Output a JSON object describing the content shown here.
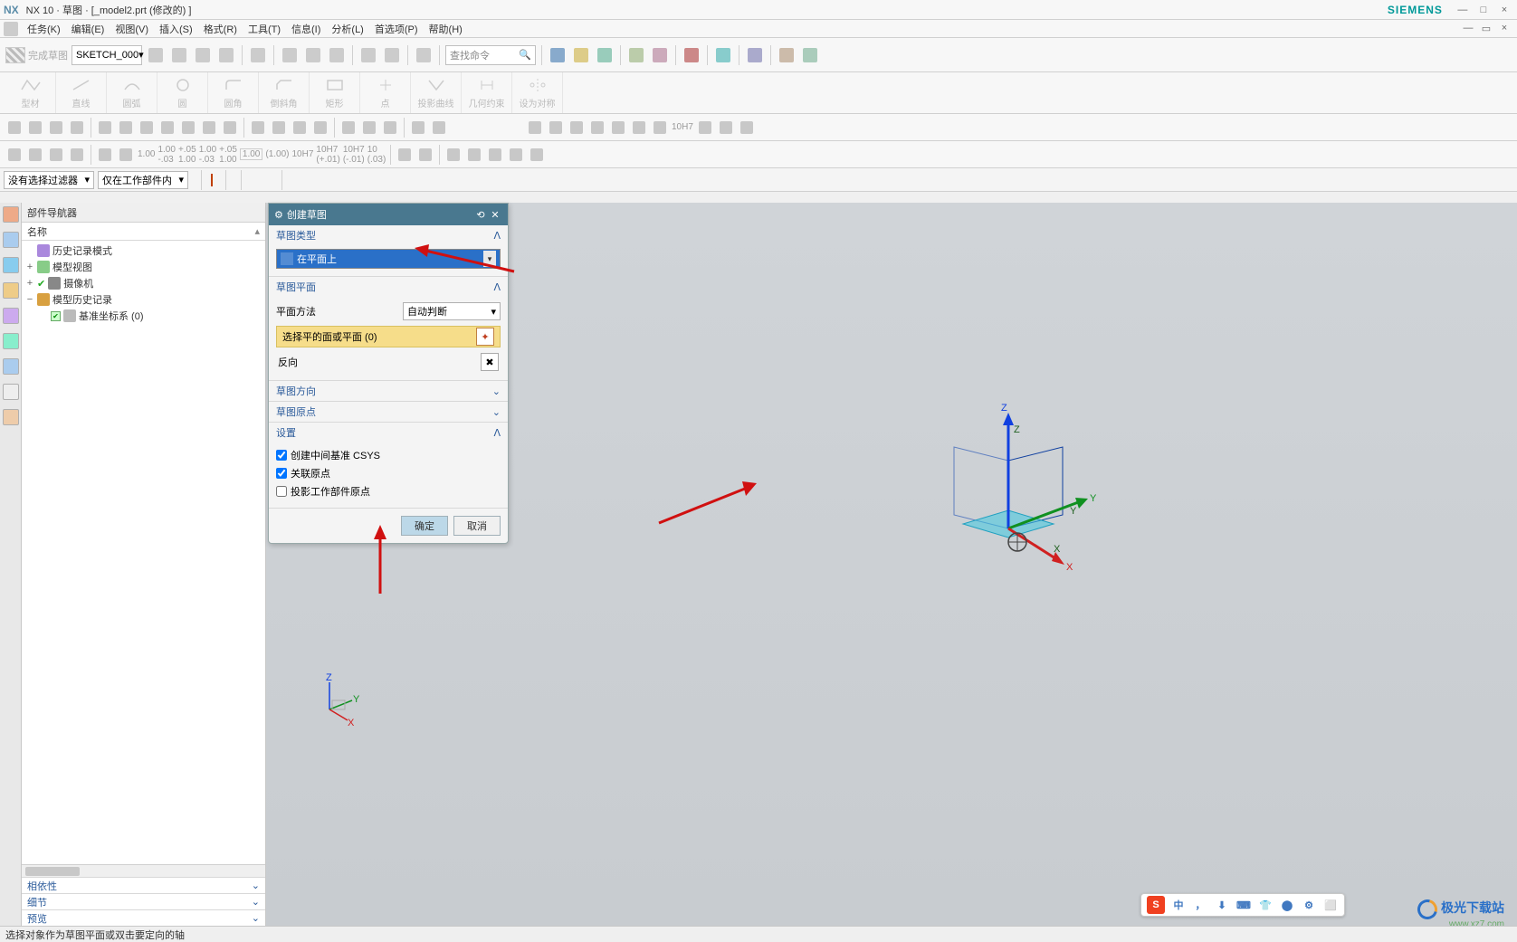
{
  "titlebar": {
    "logo": "NX",
    "title": "NX 10 · 草图 · [_model2.prt  (修改的)  ]",
    "brand": "SIEMENS",
    "min": "—",
    "max": "□",
    "close": "×"
  },
  "menu": {
    "items": [
      "任务(K)",
      "编辑(E)",
      "视图(V)",
      "插入(S)",
      "格式(R)",
      "工具(T)",
      "信息(I)",
      "分析(L)",
      "首选项(P)",
      "帮助(H)"
    ],
    "minbtn": "—",
    "maxbtn": "▭",
    "closebtn": "×"
  },
  "toolbar1": {
    "finish": "完成草图",
    "sketch_name": "SKETCH_000",
    "search_placeholder": "查找命令"
  },
  "ribbon": {
    "items": [
      "型材",
      "直线",
      "圆弧",
      "圆",
      "圆角",
      "倒斜角",
      "矩形",
      "点",
      "投影曲线",
      "几何约束",
      "设为对称"
    ]
  },
  "filters": {
    "filter_label": "没有选择过滤器",
    "scope_label": "仅在工作部件内"
  },
  "nav": {
    "title": "部件导航器",
    "col": "名称",
    "items": {
      "history_mode": "历史记录模式",
      "model_view": "模型视图",
      "camera": "摄像机",
      "model_history": "模型历史记录",
      "datum_csys": "基准坐标系 (0)"
    },
    "collapse": {
      "depend": "相依性",
      "detail": "细节",
      "preview": "预览"
    }
  },
  "dialog": {
    "title": "创建草图",
    "sections": {
      "type": "草图类型",
      "plane": "草图平面",
      "orient": "草图方向",
      "origin": "草图原点",
      "settings": "设置"
    },
    "type_value": "在平面上",
    "plane_method_label": "平面方法",
    "plane_method_value": "自动判断",
    "select_plane": "选择平的面或平面 (0)",
    "reverse": "反向",
    "cb_csys": "创建中间基准 CSYS",
    "cb_assoc_origin": "关联原点",
    "cb_project_origin": "投影工作部件原点",
    "ok": "确定",
    "cancel": "取消"
  },
  "coord": {
    "x": "X",
    "y": "Y",
    "z": "Z"
  },
  "status": {
    "msg": "选择对象作为草图平面或双击要定向的轴"
  },
  "ime": {
    "logo": "S",
    "btns": [
      "中",
      "，",
      "⬇",
      "⌨",
      "👕",
      "⬤",
      "⚙",
      "⬜"
    ]
  },
  "watermark": {
    "text": "极光下载站",
    "url": "www.xz7.com"
  }
}
